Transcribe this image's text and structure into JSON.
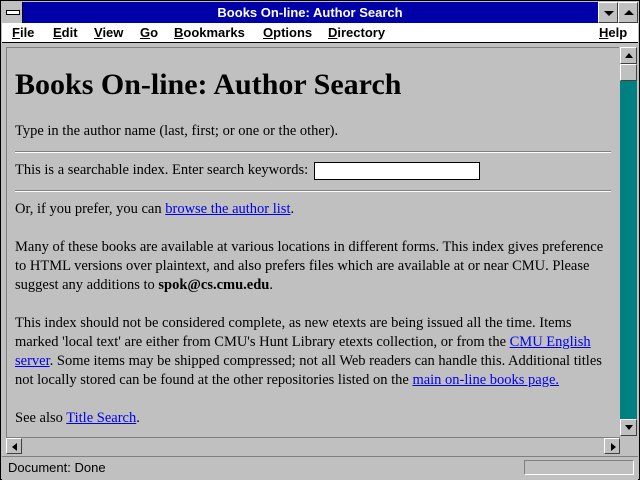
{
  "window": {
    "title": "Books On-line: Author Search",
    "title_bar_color": "#0000a8",
    "scrollbar_track_color": "#008080"
  },
  "menubar": {
    "items": [
      "File",
      "Edit",
      "View",
      "Go",
      "Bookmarks",
      "Options",
      "Directory"
    ],
    "help": "Help"
  },
  "page": {
    "heading": "Books On-line: Author Search",
    "intro": "Type in the author name (last, first; or one or the other).",
    "search_label": "This is a searchable index. Enter search keywords:",
    "search_value": "",
    "browse_prefix": "Or, if you prefer, you can ",
    "browse_link": "browse the author list",
    "browse_suffix": ".",
    "para1_text": "Many of these books are available at various locations in different forms. This index gives preference to HTML versions over plaintext, and also prefers files which are available at or near CMU. Please suggest any additions to ",
    "para1_email": "spok@cs.cmu.edu",
    "para1_end": ".",
    "para2_a": "This index should not be considered complete, as new etexts are being issued all the time. Items marked 'local text' are either from CMU's Hunt Library etexts collection, or from the ",
    "para2_link1": "CMU English server",
    "para2_b": ". Some items may be shipped compressed; not all Web readers can handle this. Additional titles not locally stored can be found at the other repositories listed on the ",
    "para2_link2": "main on-line books page.",
    "see_also_prefix": "See also ",
    "see_also_link": "Title Search",
    "see_also_suffix": "."
  },
  "status": {
    "text": "Document: Done"
  }
}
